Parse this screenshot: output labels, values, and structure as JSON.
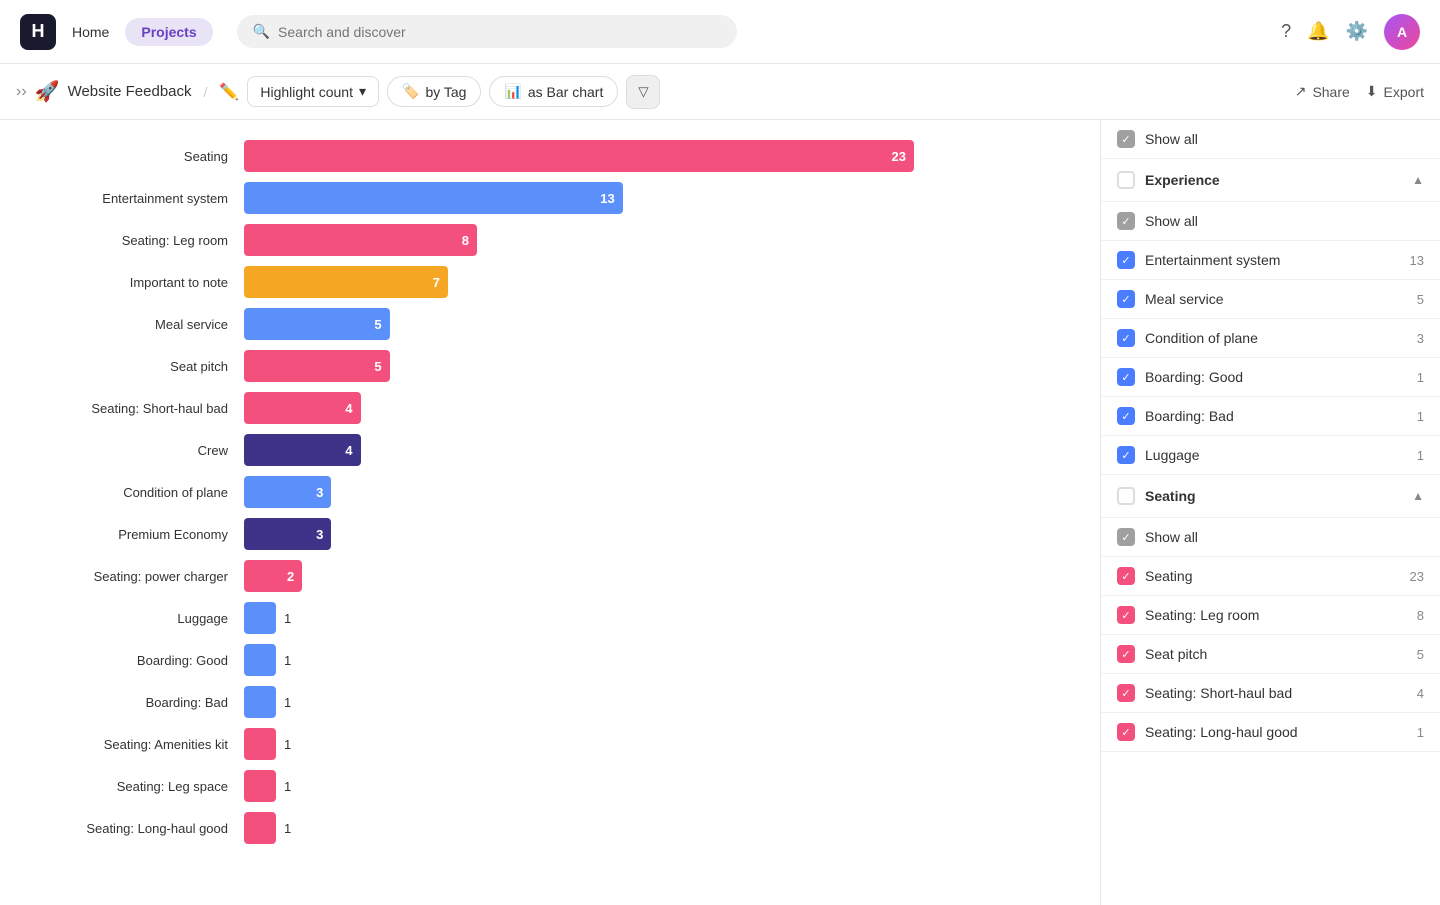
{
  "nav": {
    "logo": "H",
    "home": "Home",
    "projects": "Projects",
    "search_placeholder": "Search and discover"
  },
  "toolbar": {
    "breadcrumb_label": "Website Feedback",
    "metric_label": "Highlight count",
    "by_tag_label": "by Tag",
    "as_bar_chart_label": "as Bar chart",
    "share_label": "Share",
    "export_label": "Export"
  },
  "chart": {
    "bars": [
      {
        "label": "Seating",
        "value": 23,
        "color": "#f4507d",
        "pct": 100
      },
      {
        "label": "Entertainment system",
        "value": 13,
        "color": "#5b8ff9",
        "pct": 56
      },
      {
        "label": "Seating: Leg room",
        "value": 8,
        "color": "#f4507d",
        "pct": 34
      },
      {
        "label": "Important to note",
        "value": 7,
        "color": "#f5a623",
        "pct": 30
      },
      {
        "label": "Meal service",
        "value": 5,
        "color": "#5b8ff9",
        "pct": 21
      },
      {
        "label": "Seat pitch",
        "value": 5,
        "color": "#f4507d",
        "pct": 21
      },
      {
        "label": "Seating: Short-haul bad",
        "value": 4,
        "color": "#f4507d",
        "pct": 17
      },
      {
        "label": "Crew",
        "value": 4,
        "color": "#3d3388",
        "pct": 17
      },
      {
        "label": "Condition of plane",
        "value": 3,
        "color": "#5b8ff9",
        "pct": 13
      },
      {
        "label": "Premium Economy",
        "value": 3,
        "color": "#3d3388",
        "pct": 13
      },
      {
        "label": "Seating: power charger",
        "value": 2,
        "color": "#f4507d",
        "pct": 8
      },
      {
        "label": "Luggage",
        "value": 1,
        "color": "#5b8ff9",
        "small": true
      },
      {
        "label": "Boarding: Good",
        "value": 1,
        "color": "#5b8ff9",
        "small": true
      },
      {
        "label": "Boarding: Bad",
        "value": 1,
        "color": "#5b8ff9",
        "small": true
      },
      {
        "label": "Seating: Amenities kit",
        "value": 1,
        "color": "#f4507d",
        "small": true
      },
      {
        "label": "Seating: Leg space",
        "value": 1,
        "color": "#f4507d",
        "small": true
      },
      {
        "label": "Seating: Long-haul good",
        "value": 1,
        "color": "#f4507d",
        "small": true
      }
    ]
  },
  "sidebar": {
    "show_all_top": "Show all",
    "sections": [
      {
        "name": "Experience",
        "show_all": "Show all",
        "items": [
          {
            "label": "Entertainment system",
            "count": 13,
            "type": "blue"
          },
          {
            "label": "Meal service",
            "count": 5,
            "type": "blue"
          },
          {
            "label": "Condition of plane",
            "count": 3,
            "type": "blue"
          },
          {
            "label": "Boarding: Good",
            "count": 1,
            "type": "blue"
          },
          {
            "label": "Boarding: Bad",
            "count": 1,
            "type": "blue"
          },
          {
            "label": "Luggage",
            "count": 1,
            "type": "blue"
          }
        ]
      },
      {
        "name": "Seating",
        "show_all": "Show all",
        "items": [
          {
            "label": "Seating",
            "count": 23,
            "type": "pink"
          },
          {
            "label": "Seating: Leg room",
            "count": 8,
            "type": "pink"
          },
          {
            "label": "Seat pitch",
            "count": 5,
            "type": "pink"
          },
          {
            "label": "Seating: Short-haul bad",
            "count": 4,
            "type": "pink"
          },
          {
            "label": "Seating: Long-haul good",
            "count": 1,
            "type": "pink"
          }
        ]
      }
    ]
  }
}
